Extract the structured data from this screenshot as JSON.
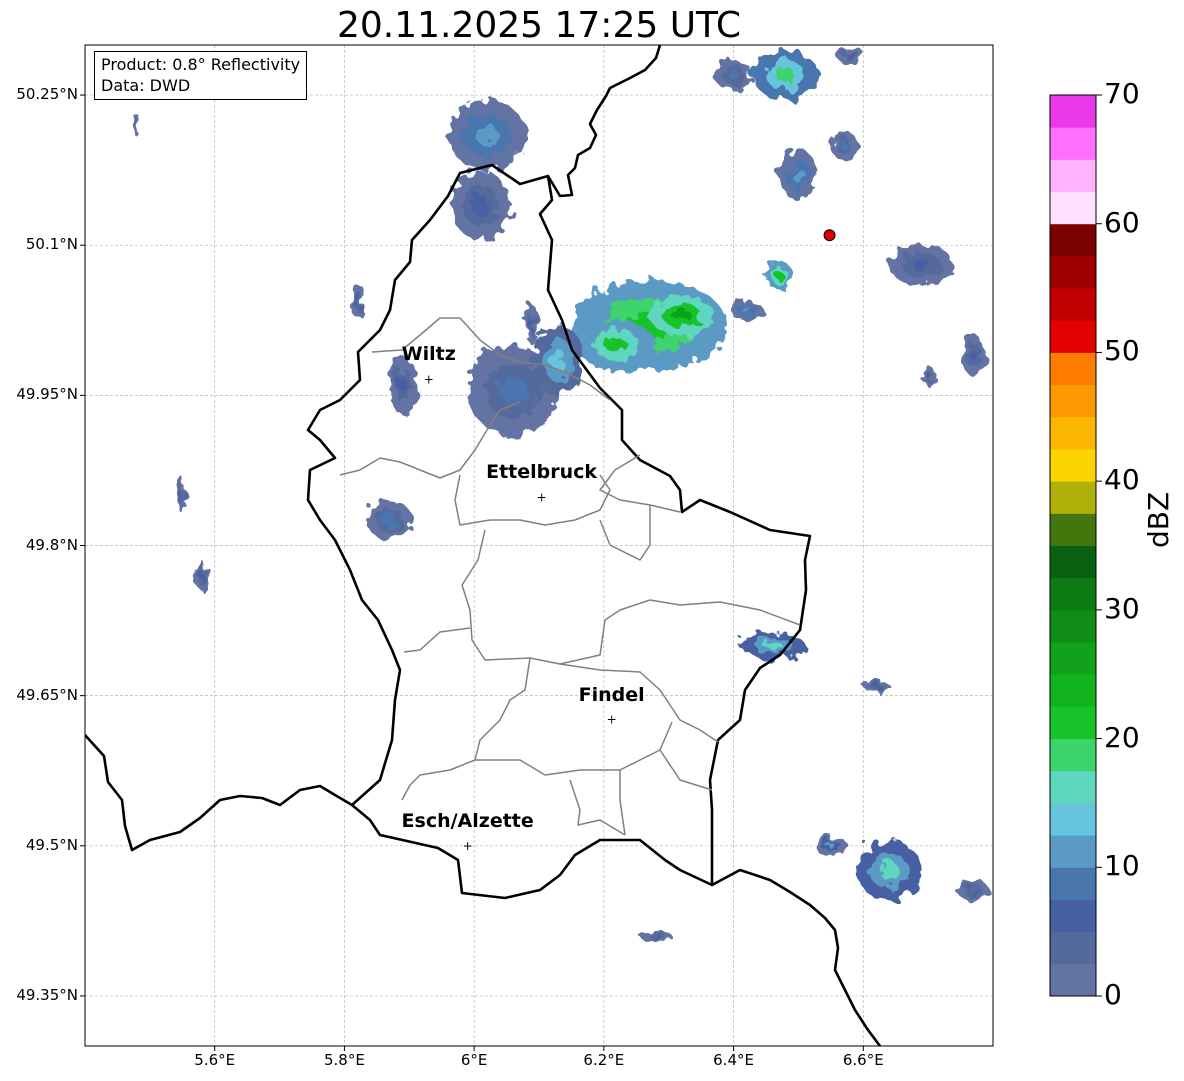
{
  "title": "20.11.2025 17:25 UTC",
  "info": {
    "product": "Product: 0.8° Reflectivity",
    "data": "Data: DWD"
  },
  "map": {
    "lon_range": [
      5.4,
      6.8
    ],
    "lat_range": [
      49.3,
      50.3
    ],
    "lat_ticks": [
      {
        "value": 50.25,
        "label": "50.25°N"
      },
      {
        "value": 50.1,
        "label": "50.1°N"
      },
      {
        "value": 49.95,
        "label": "49.95°N"
      },
      {
        "value": 49.8,
        "label": "49.8°N"
      },
      {
        "value": 49.65,
        "label": "49.65°N"
      },
      {
        "value": 49.5,
        "label": "49.5°N"
      },
      {
        "value": 49.35,
        "label": "49.35°N"
      }
    ],
    "lon_ticks": [
      {
        "value": 5.6,
        "label": "5.6°E"
      },
      {
        "value": 5.8,
        "label": "5.8°E"
      },
      {
        "value": 6.0,
        "label": "6°E"
      },
      {
        "value": 6.2,
        "label": "6.2°E"
      },
      {
        "value": 6.4,
        "label": "6.4°E"
      },
      {
        "value": 6.6,
        "label": "6.6°E"
      }
    ],
    "cities": [
      {
        "name": "Wiltz",
        "lon": 5.93,
        "lat": 49.966
      },
      {
        "name": "Ettelbruck",
        "lon": 6.104,
        "lat": 49.848
      },
      {
        "name": "Findel",
        "lon": 6.212,
        "lat": 49.626
      },
      {
        "name": "Esch/Alzette",
        "lon": 5.99,
        "lat": 49.5
      }
    ],
    "radar_site": {
      "lon": 6.548,
      "lat": 50.11,
      "color": "#e00000"
    },
    "echoes": [
      {
        "lon": 6.27,
        "lat": 50.02,
        "rx": 0.12,
        "ry": 0.045,
        "dbz": 22
      },
      {
        "lon": 6.32,
        "lat": 50.03,
        "rx": 0.05,
        "ry": 0.02,
        "dbz": 26
      },
      {
        "lon": 6.22,
        "lat": 50.0,
        "rx": 0.06,
        "ry": 0.025,
        "dbz": 20
      },
      {
        "lon": 6.06,
        "lat": 49.955,
        "rx": 0.07,
        "ry": 0.045,
        "dbz": 8
      },
      {
        "lon": 6.13,
        "lat": 49.985,
        "rx": 0.04,
        "ry": 0.035,
        "dbz": 14
      },
      {
        "lon": 6.02,
        "lat": 50.21,
        "rx": 0.06,
        "ry": 0.035,
        "dbz": 12
      },
      {
        "lon": 6.01,
        "lat": 50.14,
        "rx": 0.045,
        "ry": 0.035,
        "dbz": 6
      },
      {
        "lon": 6.48,
        "lat": 50.27,
        "rx": 0.05,
        "ry": 0.025,
        "dbz": 18
      },
      {
        "lon": 6.4,
        "lat": 50.27,
        "rx": 0.03,
        "ry": 0.015,
        "dbz": 8
      },
      {
        "lon": 6.58,
        "lat": 50.29,
        "rx": 0.02,
        "ry": 0.01,
        "dbz": 6
      },
      {
        "lon": 6.5,
        "lat": 50.17,
        "rx": 0.03,
        "ry": 0.025,
        "dbz": 12
      },
      {
        "lon": 6.57,
        "lat": 50.2,
        "rx": 0.02,
        "ry": 0.015,
        "dbz": 8
      },
      {
        "lon": 6.47,
        "lat": 50.07,
        "rx": 0.02,
        "ry": 0.015,
        "dbz": 20
      },
      {
        "lon": 6.42,
        "lat": 50.035,
        "rx": 0.025,
        "ry": 0.01,
        "dbz": 12
      },
      {
        "lon": 5.89,
        "lat": 49.96,
        "rx": 0.02,
        "ry": 0.03,
        "dbz": 6
      },
      {
        "lon": 5.87,
        "lat": 49.825,
        "rx": 0.035,
        "ry": 0.02,
        "dbz": 8
      },
      {
        "lon": 6.46,
        "lat": 49.7,
        "rx": 0.05,
        "ry": 0.013,
        "dbz": 16
      },
      {
        "lon": 6.64,
        "lat": 49.475,
        "rx": 0.05,
        "ry": 0.03,
        "dbz": 16
      },
      {
        "lon": 6.55,
        "lat": 49.5,
        "rx": 0.025,
        "ry": 0.01,
        "dbz": 10
      },
      {
        "lon": 6.77,
        "lat": 49.455,
        "rx": 0.025,
        "ry": 0.01,
        "dbz": 6
      },
      {
        "lon": 6.69,
        "lat": 50.08,
        "rx": 0.05,
        "ry": 0.02,
        "dbz": 6
      },
      {
        "lon": 6.77,
        "lat": 49.99,
        "rx": 0.02,
        "ry": 0.02,
        "dbz": 6
      },
      {
        "lon": 6.28,
        "lat": 49.41,
        "rx": 0.025,
        "ry": 0.005,
        "dbz": 6
      },
      {
        "lon": 5.82,
        "lat": 50.045,
        "rx": 0.008,
        "ry": 0.018,
        "dbz": 6
      },
      {
        "lon": 5.48,
        "lat": 50.22,
        "rx": 0.004,
        "ry": 0.012,
        "dbz": 6
      },
      {
        "lon": 5.55,
        "lat": 49.85,
        "rx": 0.008,
        "ry": 0.018,
        "dbz": 6
      },
      {
        "lon": 5.58,
        "lat": 49.77,
        "rx": 0.008,
        "ry": 0.015,
        "dbz": 6
      },
      {
        "lon": 6.09,
        "lat": 50.02,
        "rx": 0.01,
        "ry": 0.02,
        "dbz": 6
      },
      {
        "lon": 6.7,
        "lat": 49.97,
        "rx": 0.01,
        "ry": 0.01,
        "dbz": 6
      },
      {
        "lon": 6.62,
        "lat": 49.66,
        "rx": 0.02,
        "ry": 0.006,
        "dbz": 6
      }
    ]
  },
  "colorbar": {
    "label": "dBZ",
    "min": 0,
    "max": 70,
    "step": 2.5,
    "ticks": [
      "0",
      "10",
      "20",
      "30",
      "40",
      "50",
      "60",
      "70"
    ],
    "colors": [
      "#6373a3",
      "#556a9c",
      "#4660a3",
      "#4a76ae",
      "#5a9ac4",
      "#66c4dd",
      "#5ed6c0",
      "#3dd46c",
      "#16c42a",
      "#12b41e",
      "#11a11a",
      "#108d16",
      "#0c7b12",
      "#096112",
      "#45760e",
      "#aeb109",
      "#fcd500",
      "#fcb602",
      "#fd9800",
      "#fe7c01",
      "#e40000",
      "#c20000",
      "#a10000",
      "#7b0000",
      "#ffe2ff",
      "#ffb3ff",
      "#ff70ff",
      "#ea39ea"
    ]
  }
}
